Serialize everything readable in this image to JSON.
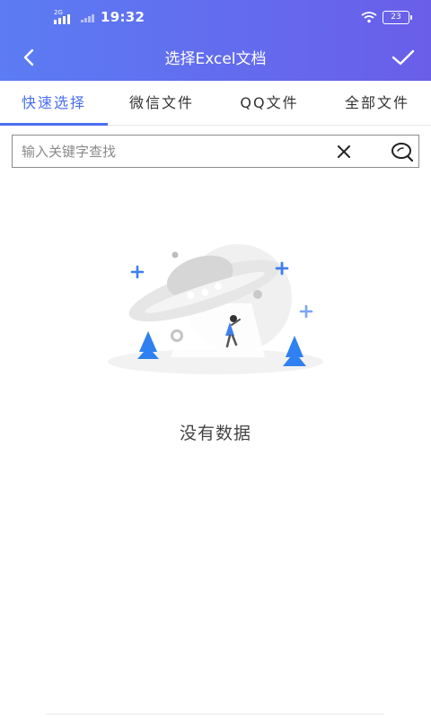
{
  "status_bar": {
    "network_tag": "2G",
    "time": "19:32",
    "battery": "23"
  },
  "header": {
    "title": "选择Excel文档"
  },
  "tabs": [
    {
      "label": "快速选择",
      "active": true
    },
    {
      "label": "微信文件",
      "active": false
    },
    {
      "label": "QQ文件",
      "active": false
    },
    {
      "label": "全部文件",
      "active": false
    }
  ],
  "search": {
    "placeholder": "输入关键字查找",
    "value": ""
  },
  "empty_state": {
    "message": "没有数据"
  },
  "colors": {
    "header_start": "#5b7cf3",
    "header_end": "#6a5ee9",
    "accent": "#4a6ef0",
    "illustration_blue": "#3d7ff0"
  }
}
